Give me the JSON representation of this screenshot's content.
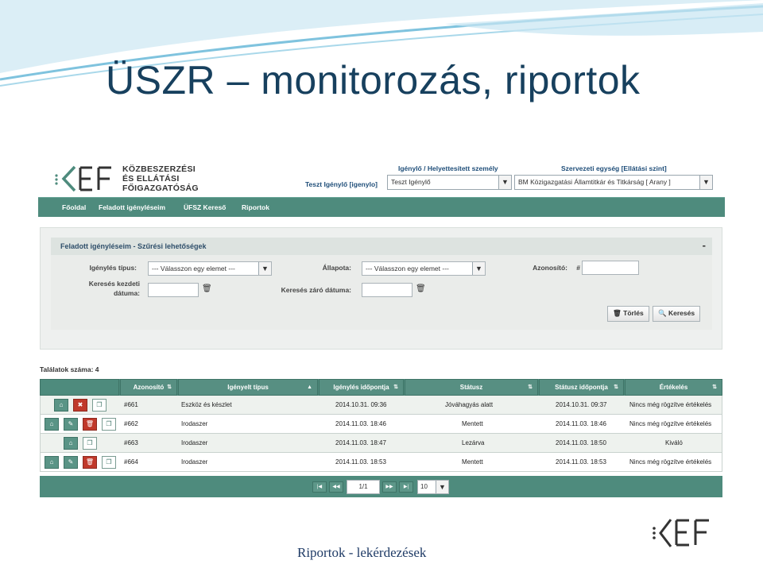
{
  "slide": {
    "title": "ÜSZR – monitorozás, riportok",
    "footer": "Riportok - lekérdezések"
  },
  "header": {
    "logo_lines": [
      "KÖZBESZERZÉSI",
      "ÉS ELLÁTÁSI",
      "FŐIGAZGATÓSÁG"
    ],
    "user": "Teszt Igénylő [igenylo]",
    "role_label": "Igénylő / Helyettesített személy",
    "role_value": "Teszt Igénylő",
    "unit_label": "Szervezeti egység [Ellátási szint]",
    "unit_value": "BM Közigazgatási Államtitkár és Titkárság [ Arany ]"
  },
  "nav": [
    "Főoldal",
    "Feladott igényléseim",
    "ÜFSZ Kereső",
    "Riportok"
  ],
  "filter": {
    "title": "Feladott igényléseim - Szűrési lehetőségek",
    "minimize": "-",
    "type_label": "Igénylés típus:",
    "type_value": "--- Válasszon egy elemet ---",
    "state_label": "Állapota:",
    "state_value": "--- Válasszon egy elemet ---",
    "id_label": "Azonosító:",
    "id_prefix": "#",
    "start_label": "Keresés kezdeti",
    "start_label2": "dátuma:",
    "end_label": "Keresés záró dátuma:",
    "clear_label": "Törlés",
    "search_label": "Keresés"
  },
  "results": {
    "count_label": "Találatok száma: 4",
    "columns": [
      "Azonosító",
      "Igényelt típus",
      "Igénylés időpontja",
      "Státusz",
      "Státusz időpontja",
      "Értékelés"
    ],
    "rows": [
      {
        "id": "#661",
        "type": "Eszköz és készlet",
        "date": "2014.10.31. 09:36",
        "status": "Jóváhagyás alatt",
        "status_date": "2014.10.31. 09:37",
        "rating": "Nincs még rögzítve értékelés"
      },
      {
        "id": "#662",
        "type": "Irodaszer",
        "date": "2014.11.03. 18:46",
        "status": "Mentett",
        "status_date": "2014.11.03. 18:46",
        "rating": "Nincs még rögzítve értékelés"
      },
      {
        "id": "#663",
        "type": "Irodaszer",
        "date": "2014.11.03. 18:47",
        "status": "Lezárva",
        "status_date": "2014.11.03. 18:50",
        "rating": "Kiváló"
      },
      {
        "id": "#664",
        "type": "Irodaszer",
        "date": "2014.11.03. 18:53",
        "status": "Mentett",
        "status_date": "2014.11.03. 18:53",
        "rating": "Nincs még rögzítve értékelés"
      }
    ]
  },
  "pager": {
    "page": "1/1",
    "page_size": "10"
  },
  "colors": {
    "accent": "#4e8b7d",
    "title": "#17405e",
    "danger": "#c0392b"
  }
}
